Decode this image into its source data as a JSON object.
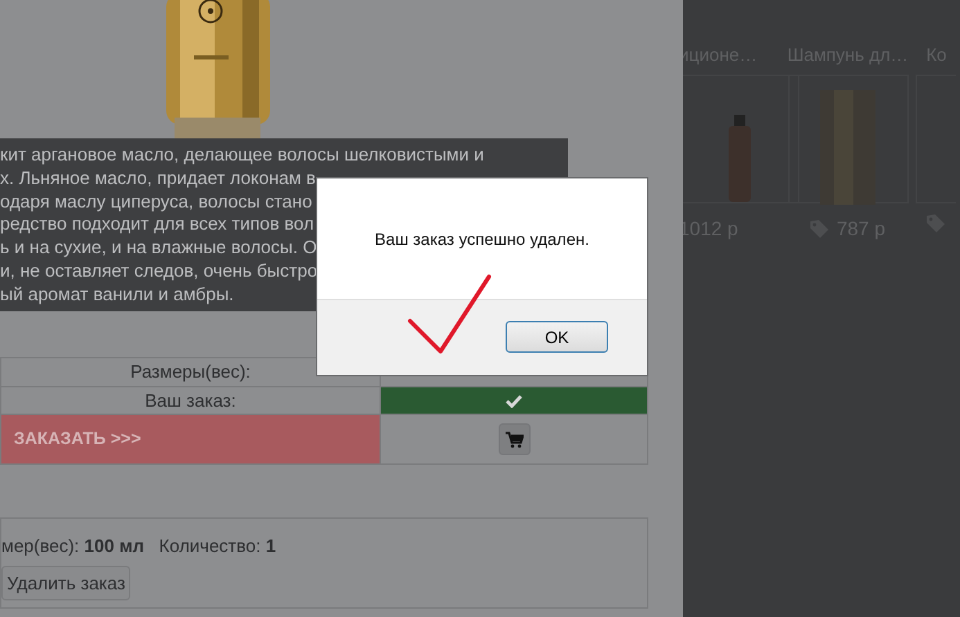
{
  "product": {
    "description_lines": [
      "кит аргановое масло, делающее волосы шелковистыми и",
      "х. Льняное масло, придает локонам в",
      "одаря маслу циперуса, волосы стано",
      "редство подходит для всех типов вол",
      "ь и на сухие, и на влажные волосы. О",
      "и, не оставляет следов, очень быстро",
      "ый аромат ванили и амбры."
    ]
  },
  "order_table": [
    {
      "kind": "label",
      "label": "Размеры(вес):"
    },
    {
      "kind": "check",
      "label": "Ваш заказ:"
    },
    {
      "kind": "order",
      "label": "ЗАКАЗАТЬ >>>"
    }
  ],
  "order_summary": {
    "text": "мер(вес): **100 мл**   Количество: **1**",
    "delete_button": "Удалить заказ"
  },
  "carousel": [
    {
      "name": "иционе…",
      "price": "1012 р",
      "tag": false
    },
    {
      "name": "Шампунь дл…",
      "price": "787 р",
      "tag": true
    },
    {
      "name": "Ко",
      "tag": true
    }
  ],
  "dialog": {
    "message": "Ваш заказ успешно удален.",
    "ok_button": "OK"
  }
}
